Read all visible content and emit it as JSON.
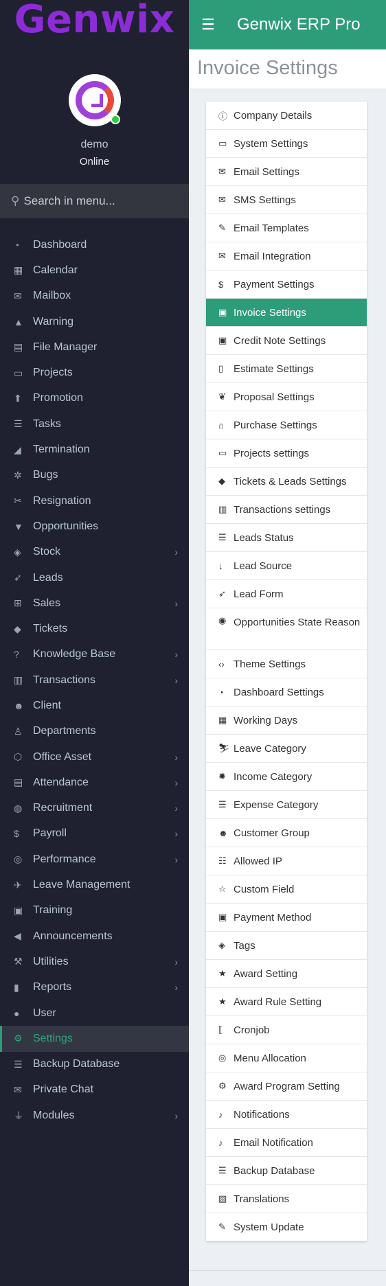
{
  "brand": {
    "logo_text": "Genwix",
    "app_title": "Genwix ERP Pro"
  },
  "user": {
    "name": "demo",
    "status": "Online"
  },
  "search": {
    "placeholder": "Search in menu..."
  },
  "page": {
    "title": "Invoice Settings"
  },
  "menu": [
    {
      "label": "Dashboard",
      "icon": "dashboard-icon",
      "glyph": "◔",
      "chevron": false
    },
    {
      "label": "Calendar",
      "icon": "calendar-icon",
      "glyph": "▦",
      "chevron": false
    },
    {
      "label": "Mailbox",
      "icon": "envelope-icon",
      "glyph": "✉",
      "chevron": false
    },
    {
      "label": "Warning",
      "icon": "warning-icon",
      "glyph": "▲",
      "chevron": false
    },
    {
      "label": "File Manager",
      "icon": "file-icon",
      "glyph": "▤",
      "chevron": false
    },
    {
      "label": "Projects",
      "icon": "folder-icon",
      "glyph": "▭",
      "chevron": false
    },
    {
      "label": "Promotion",
      "icon": "arrow-up-circle-icon",
      "glyph": "⬆",
      "chevron": false
    },
    {
      "label": "Tasks",
      "icon": "tasks-icon",
      "glyph": "☰",
      "chevron": false
    },
    {
      "label": "Termination",
      "icon": "eraser-icon",
      "glyph": "◢",
      "chevron": false
    },
    {
      "label": "Bugs",
      "icon": "bug-icon",
      "glyph": "✲",
      "chevron": false
    },
    {
      "label": "Resignation",
      "icon": "scissors-icon",
      "glyph": "✂",
      "chevron": false
    },
    {
      "label": "Opportunities",
      "icon": "filter-icon",
      "glyph": "▼",
      "chevron": false
    },
    {
      "label": "Stock",
      "icon": "layers-icon",
      "glyph": "◈",
      "chevron": true
    },
    {
      "label": "Leads",
      "icon": "rocket-icon",
      "glyph": "➶",
      "chevron": false
    },
    {
      "label": "Sales",
      "icon": "cart-icon",
      "glyph": "⊞",
      "chevron": true
    },
    {
      "label": "Tickets",
      "icon": "ticket-icon",
      "glyph": "◆",
      "chevron": false
    },
    {
      "label": "Knowledge Base",
      "icon": "question-circle-icon",
      "glyph": "?",
      "chevron": true
    },
    {
      "label": "Transactions",
      "icon": "building-icon",
      "glyph": "▥",
      "chevron": true
    },
    {
      "label": "Client",
      "icon": "users-icon",
      "glyph": "☻",
      "chevron": false
    },
    {
      "label": "Departments",
      "icon": "user-tie-icon",
      "glyph": "♙",
      "chevron": false
    },
    {
      "label": "Office Asset",
      "icon": "cube-icon",
      "glyph": "⬡",
      "chevron": true
    },
    {
      "label": "Attendance",
      "icon": "file-text-icon",
      "glyph": "▤",
      "chevron": true
    },
    {
      "label": "Recruitment",
      "icon": "globe-icon",
      "glyph": "◍",
      "chevron": true
    },
    {
      "label": "Payroll",
      "icon": "dollar-icon",
      "glyph": "$",
      "chevron": true
    },
    {
      "label": "Performance",
      "icon": "dribbble-icon",
      "glyph": "◎",
      "chevron": true
    },
    {
      "label": "Leave Management",
      "icon": "plane-icon",
      "glyph": "✈",
      "chevron": false
    },
    {
      "label": "Training",
      "icon": "briefcase-icon",
      "glyph": "▣",
      "chevron": false
    },
    {
      "label": "Announcements",
      "icon": "bullhorn-icon",
      "glyph": "◀",
      "chevron": false
    },
    {
      "label": "Utilities",
      "icon": "gavel-icon",
      "glyph": "⚒",
      "chevron": true
    },
    {
      "label": "Reports",
      "icon": "bar-chart-icon",
      "glyph": "▮",
      "chevron": true
    },
    {
      "label": "User",
      "icon": "user-icon",
      "glyph": "●",
      "chevron": false
    },
    {
      "label": "Settings",
      "icon": "cogs-icon",
      "glyph": "⚙",
      "chevron": false,
      "active": true
    },
    {
      "label": "Backup Database",
      "icon": "database-icon",
      "glyph": "☰",
      "chevron": false
    },
    {
      "label": "Private Chat",
      "icon": "envelope-icon",
      "glyph": "✉",
      "chevron": false
    },
    {
      "label": "Modules",
      "icon": "plug-icon",
      "glyph": "⏚",
      "chevron": true
    }
  ],
  "settings": [
    {
      "label": "Company Details",
      "icon": "info-circle-icon",
      "glyph": "ⓘ"
    },
    {
      "label": "System Settings",
      "icon": "desktop-icon",
      "glyph": "▭"
    },
    {
      "label": "Email Settings",
      "icon": "envelope-icon",
      "glyph": "✉"
    },
    {
      "label": "SMS Settings",
      "icon": "envelope-icon",
      "glyph": "✉"
    },
    {
      "label": "Email Templates",
      "icon": "edit-icon",
      "glyph": "✎"
    },
    {
      "label": "Email Integration",
      "icon": "envelope-outline-icon",
      "glyph": "✉"
    },
    {
      "label": "Payment Settings",
      "icon": "dollar-icon",
      "glyph": "$"
    },
    {
      "label": "Invoice Settings",
      "icon": "money-icon",
      "glyph": "▣",
      "active": true
    },
    {
      "label": "Credit Note Settings",
      "icon": "money-icon",
      "glyph": "▣"
    },
    {
      "label": "Estimate Settings",
      "icon": "file-outline-icon",
      "glyph": "▯"
    },
    {
      "label": "Proposal Settings",
      "icon": "leaf-icon",
      "glyph": "❦"
    },
    {
      "label": "Purchase Settings",
      "icon": "shopping-bag-icon",
      "glyph": "⌂"
    },
    {
      "label": "Projects settings",
      "icon": "folder-open-icon",
      "glyph": "▭"
    },
    {
      "label": "Tickets & Leads Settings",
      "icon": "ticket-icon",
      "glyph": "◆"
    },
    {
      "label": "Transactions settings",
      "icon": "building-icon",
      "glyph": "▥"
    },
    {
      "label": "Leads Status",
      "icon": "list-icon",
      "glyph": "☰"
    },
    {
      "label": "Lead Source",
      "icon": "arrow-down-icon",
      "glyph": "↓"
    },
    {
      "label": "Lead Form",
      "icon": "rocket-icon",
      "glyph": "➶"
    },
    {
      "label": "Opportunities State Reason",
      "icon": "dot-circle-icon",
      "glyph": "◉",
      "tall": true
    },
    {
      "label": "Theme Settings",
      "icon": "code-icon",
      "glyph": "‹›"
    },
    {
      "label": "Dashboard Settings",
      "icon": "tachometer-icon",
      "glyph": "◔"
    },
    {
      "label": "Working Days",
      "icon": "calendar-icon",
      "glyph": "▦"
    },
    {
      "label": "Leave Category",
      "icon": "skiing-icon",
      "glyph": "⛷"
    },
    {
      "label": "Income Category",
      "icon": "certificate-icon",
      "glyph": "✹"
    },
    {
      "label": "Expense Category",
      "icon": "tasks-icon",
      "glyph": "☰"
    },
    {
      "label": "Customer Group",
      "icon": "users-icon",
      "glyph": "☻"
    },
    {
      "label": "Allowed IP",
      "icon": "server-icon",
      "glyph": "☷"
    },
    {
      "label": "Custom Field",
      "icon": "star-outline-icon",
      "glyph": "☆"
    },
    {
      "label": "Payment Method",
      "icon": "money-icon",
      "glyph": "▣"
    },
    {
      "label": "Tags",
      "icon": "tags-icon",
      "glyph": "◈"
    },
    {
      "label": "Award Setting",
      "icon": "star-icon",
      "glyph": "★"
    },
    {
      "label": "Award Rule Setting",
      "icon": "star-icon",
      "glyph": "★"
    },
    {
      "label": "Cronjob",
      "icon": "cronjob-icon",
      "glyph": "⟦"
    },
    {
      "label": "Menu Allocation",
      "icon": "compass-icon",
      "glyph": "◎"
    },
    {
      "label": "Award Program Setting",
      "icon": "cog-icon",
      "glyph": "⚙"
    },
    {
      "label": "Notifications",
      "icon": "bell-icon",
      "glyph": "♪"
    },
    {
      "label": "Email Notification",
      "icon": "bell-icon",
      "glyph": "♪"
    },
    {
      "label": "Backup Database",
      "icon": "database-icon",
      "glyph": "☰"
    },
    {
      "label": "Translations",
      "icon": "language-icon",
      "glyph": "▨"
    },
    {
      "label": "System Update",
      "icon": "pencil-square-icon",
      "glyph": "✎"
    }
  ]
}
